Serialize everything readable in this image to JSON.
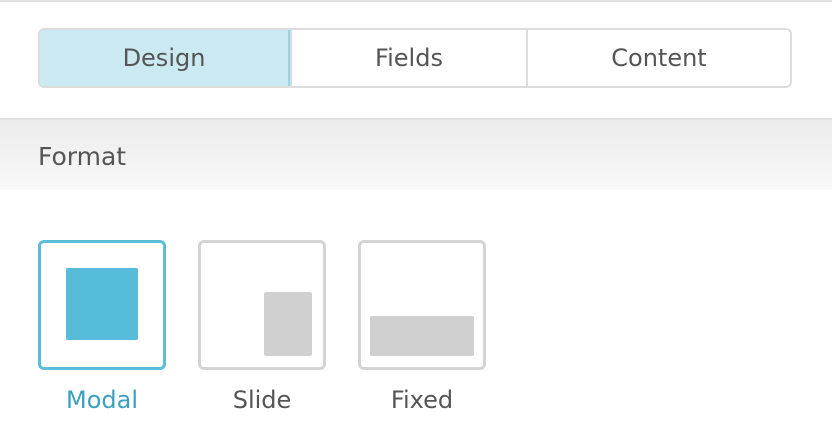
{
  "tabs": [
    {
      "label": "Design",
      "active": true
    },
    {
      "label": "Fields",
      "active": false
    },
    {
      "label": "Content",
      "active": false
    }
  ],
  "section": {
    "title": "Format"
  },
  "format_options": [
    {
      "label": "Modal",
      "selected": true
    },
    {
      "label": "Slide",
      "selected": false
    },
    {
      "label": "Fixed",
      "selected": false
    }
  ],
  "colors": {
    "accent": "#57bcd7",
    "active_tab_bg": "#cbe9f1",
    "active_label": "#3aa0c0",
    "inactive_border": "#d4d4d4",
    "placeholder_gray": "#d0d0d0"
  }
}
